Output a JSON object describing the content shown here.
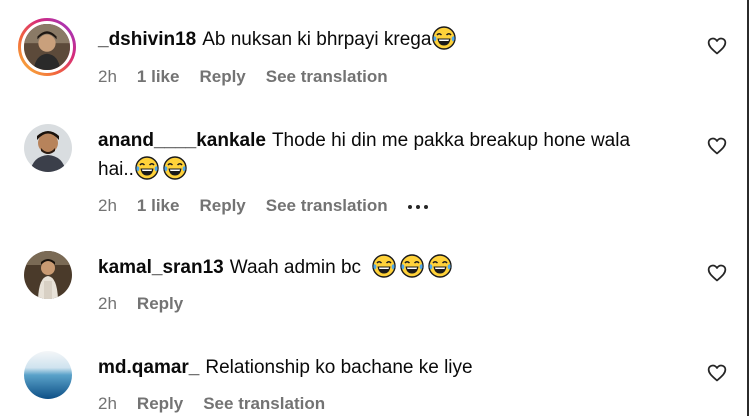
{
  "comments": [
    {
      "username": "_dshivin18",
      "text": "Ab nuksan ki bhrpayi krega",
      "emoji_count": 1,
      "time": "2h",
      "likes": "1 like",
      "reply": "Reply",
      "translation": "See translation",
      "has_story_ring": true,
      "emoji_icon": "laughing-tears-emoji",
      "heart_icon": "heart-outline-icon"
    },
    {
      "username": "anand____kankale",
      "text_line1": "Thode hi din me pakka breakup hone wala",
      "text_line2": "hai..",
      "emoji_count": 2,
      "time": "2h",
      "likes": "1 like",
      "reply": "Reply",
      "translation": "See translation",
      "more_icon": "more-options-icon",
      "heart_icon": "heart-outline-icon"
    },
    {
      "username": "kamal_sran13",
      "text": "Waah admin bc",
      "emoji_count": 3,
      "time": "2h",
      "reply": "Reply",
      "heart_icon": "heart-outline-icon"
    },
    {
      "username": "md.qamar_",
      "text": "Relationship ko bachane ke liye",
      "time": "2h",
      "reply": "Reply",
      "translation": "See translation",
      "heart_icon": "heart-outline-icon"
    }
  ],
  "colors": {
    "text": "#0a0a0a",
    "meta": "#737373",
    "story_ring": [
      "#f9c33c",
      "#d62a7a",
      "#8d3ad6"
    ]
  }
}
